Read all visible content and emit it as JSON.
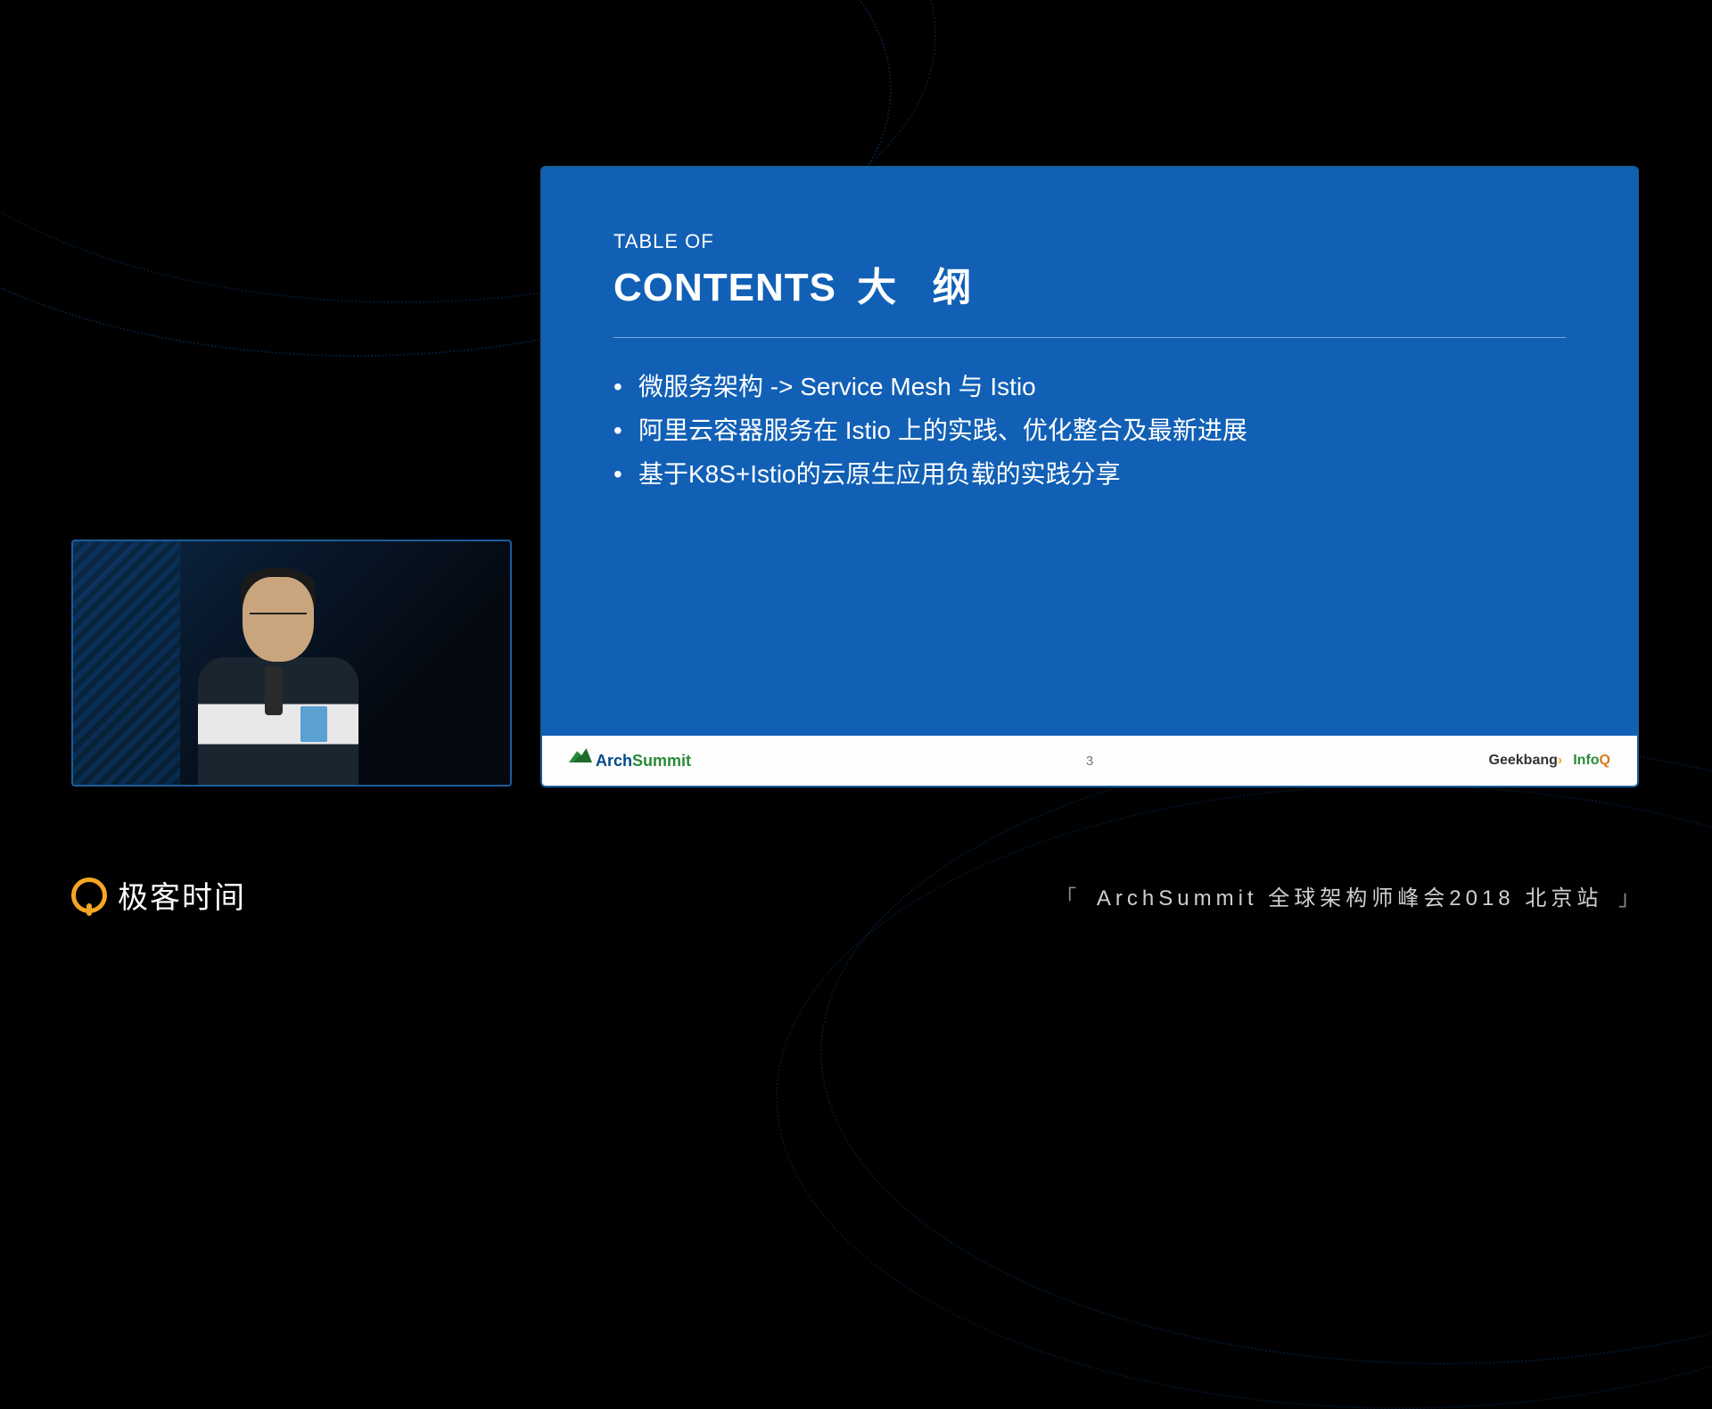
{
  "slide": {
    "table_of": "TABLE OF",
    "title_en": "CONTENTS",
    "title_zh": "大 纲",
    "bullets": [
      "微服务架构 -> Service Mesh 与 Istio",
      "阿里云容器服务在 Istio 上的实践、优化整合及最新进展",
      "基于K8S+Istio的云原生应用负载的实践分享"
    ],
    "footer": {
      "logo_arch": "Arch",
      "logo_summit": "Summit",
      "page_number": "3",
      "geekbang": "Geekbang",
      "infoq_pre": "Info",
      "infoq_q": "Q"
    }
  },
  "brand": {
    "name": "极客时间"
  },
  "event": {
    "bracket_open": "「",
    "label": "ArchSummit 全球架构师峰会2018 北京站",
    "bracket_close": "」"
  }
}
